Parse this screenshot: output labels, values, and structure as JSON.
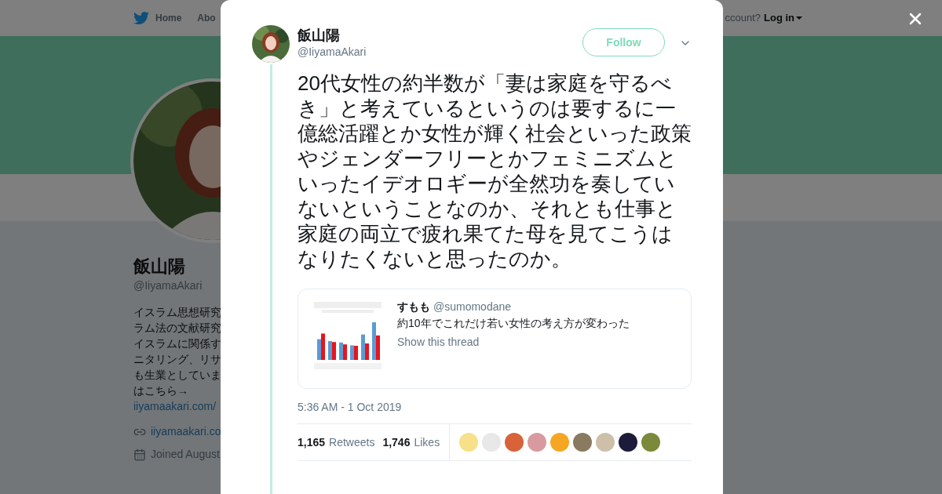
{
  "background_page": {
    "nav": {
      "items": [
        {
          "label": "Home"
        },
        {
          "label": "Abo"
        }
      ],
      "account_prompt": "ccount?",
      "login": "Log in"
    },
    "profile": {
      "name": "飯山陽",
      "handle": "@IiyamaAkari",
      "bio_lines": [
        "イスラム思想研究",
        "ラム法の文献研究",
        "イスラムに関係す",
        "ニタリング、リサ",
        "も生業としていま",
        "はこちら→"
      ],
      "bio_link": "iiyamaakari.com/",
      "website": "iiyamaakari.co",
      "joined": "Joined August"
    }
  },
  "tweet": {
    "author": {
      "name": "飯山陽",
      "handle": "@IiyamaAkari"
    },
    "follow": "Follow",
    "text": "20代女性の約半数が「妻は家庭を守るべき」と考えているというのは要するに一億総活躍とか女性が輝く社会といった政策やジェンダーフリーとかフェミニズムといったイデオロギーが全然功を奏していないということなのか、それとも仕事と家庭の両立で疲れ果てた母を見てこうはなりたくないと思ったのか。",
    "quote": {
      "name": "すもも",
      "handle": "@sumomodane",
      "text": "約10年でこれだけ若い女性の考え方が変わった",
      "thread_link": "Show this thread"
    },
    "timestamp": "5:36 AM - 1 Oct 2019",
    "stats": [
      {
        "count": "1,165",
        "label": "Retweets"
      },
      {
        "count": "1,746",
        "label": "Likes"
      }
    ],
    "likers": [
      {
        "color": "#f7e08a"
      },
      {
        "color": "#e8e8e8"
      },
      {
        "color": "#d8623a"
      },
      {
        "color": "#d89aa0"
      },
      {
        "color": "#f5a623"
      },
      {
        "color": "#8a7a60"
      },
      {
        "color": "#cdbfa8"
      },
      {
        "color": "#1c1c3a"
      },
      {
        "color": "#7a8a3a"
      }
    ]
  }
}
